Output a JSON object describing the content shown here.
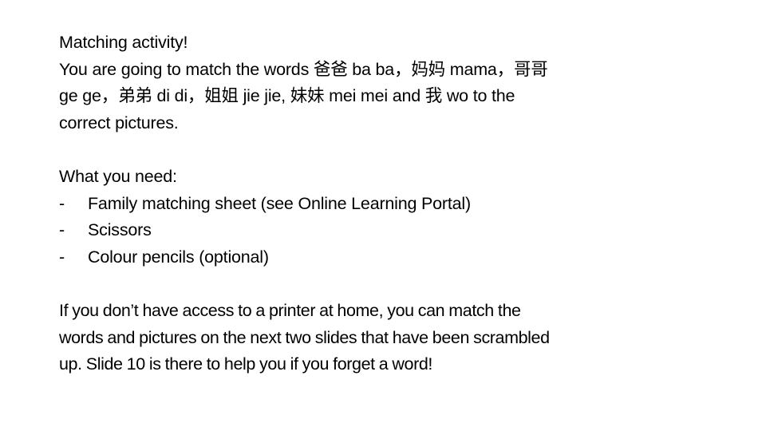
{
  "slide": {
    "intro": {
      "title": "Matching activity!",
      "lines": [
        "You are going to match the words 爸爸  ba ba，妈妈  mama，哥哥",
        "ge ge，弟弟  di di，姐姐  jie jie, 妹妹 mei mei and 我  wo to the",
        "correct pictures."
      ]
    },
    "needs": {
      "heading": "What you need:",
      "bullet_marker": "-",
      "items": [
        "Family matching sheet (see Online Learning Portal)",
        "Scissors",
        "Colour pencils (optional)"
      ]
    },
    "note": {
      "lines": [
        "If you don’t have access to a printer at home, you can match the",
        "words and pictures on the next two slides that have been scrambled",
        "up. Slide 10 is there to help you if you forget a word!"
      ]
    }
  }
}
